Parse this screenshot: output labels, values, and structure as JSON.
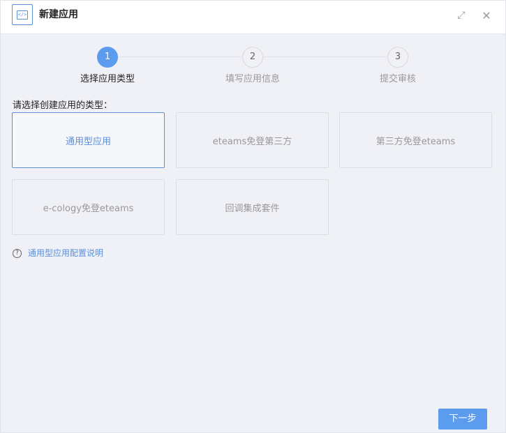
{
  "header": {
    "app_icon_glyph": "</>",
    "title": "新建应用",
    "expand_glyph": "⤢",
    "close_glyph": "✕"
  },
  "steps": [
    {
      "number": "1",
      "label": "选择应用类型",
      "active": true
    },
    {
      "number": "2",
      "label": "填写应用信息",
      "active": false
    },
    {
      "number": "3",
      "label": "提交审核",
      "active": false
    }
  ],
  "prompt": "请选择创建应用的类型：",
  "app_types": [
    {
      "label": "通用型应用",
      "selected": true
    },
    {
      "label": "eteams免登第三方",
      "selected": false
    },
    {
      "label": "第三方免登eteams",
      "selected": false
    },
    {
      "label": "e-cology免登eteams",
      "selected": false
    },
    {
      "label": "回调集成套件",
      "selected": false
    }
  ],
  "help": {
    "icon_glyph": "?",
    "link": "通用型应用配置说明"
  },
  "footer": {
    "next_label": "下一步"
  },
  "colors": {
    "accent": "#5b9cef",
    "link": "#5b8fd8",
    "background": "#f0f1f6"
  }
}
